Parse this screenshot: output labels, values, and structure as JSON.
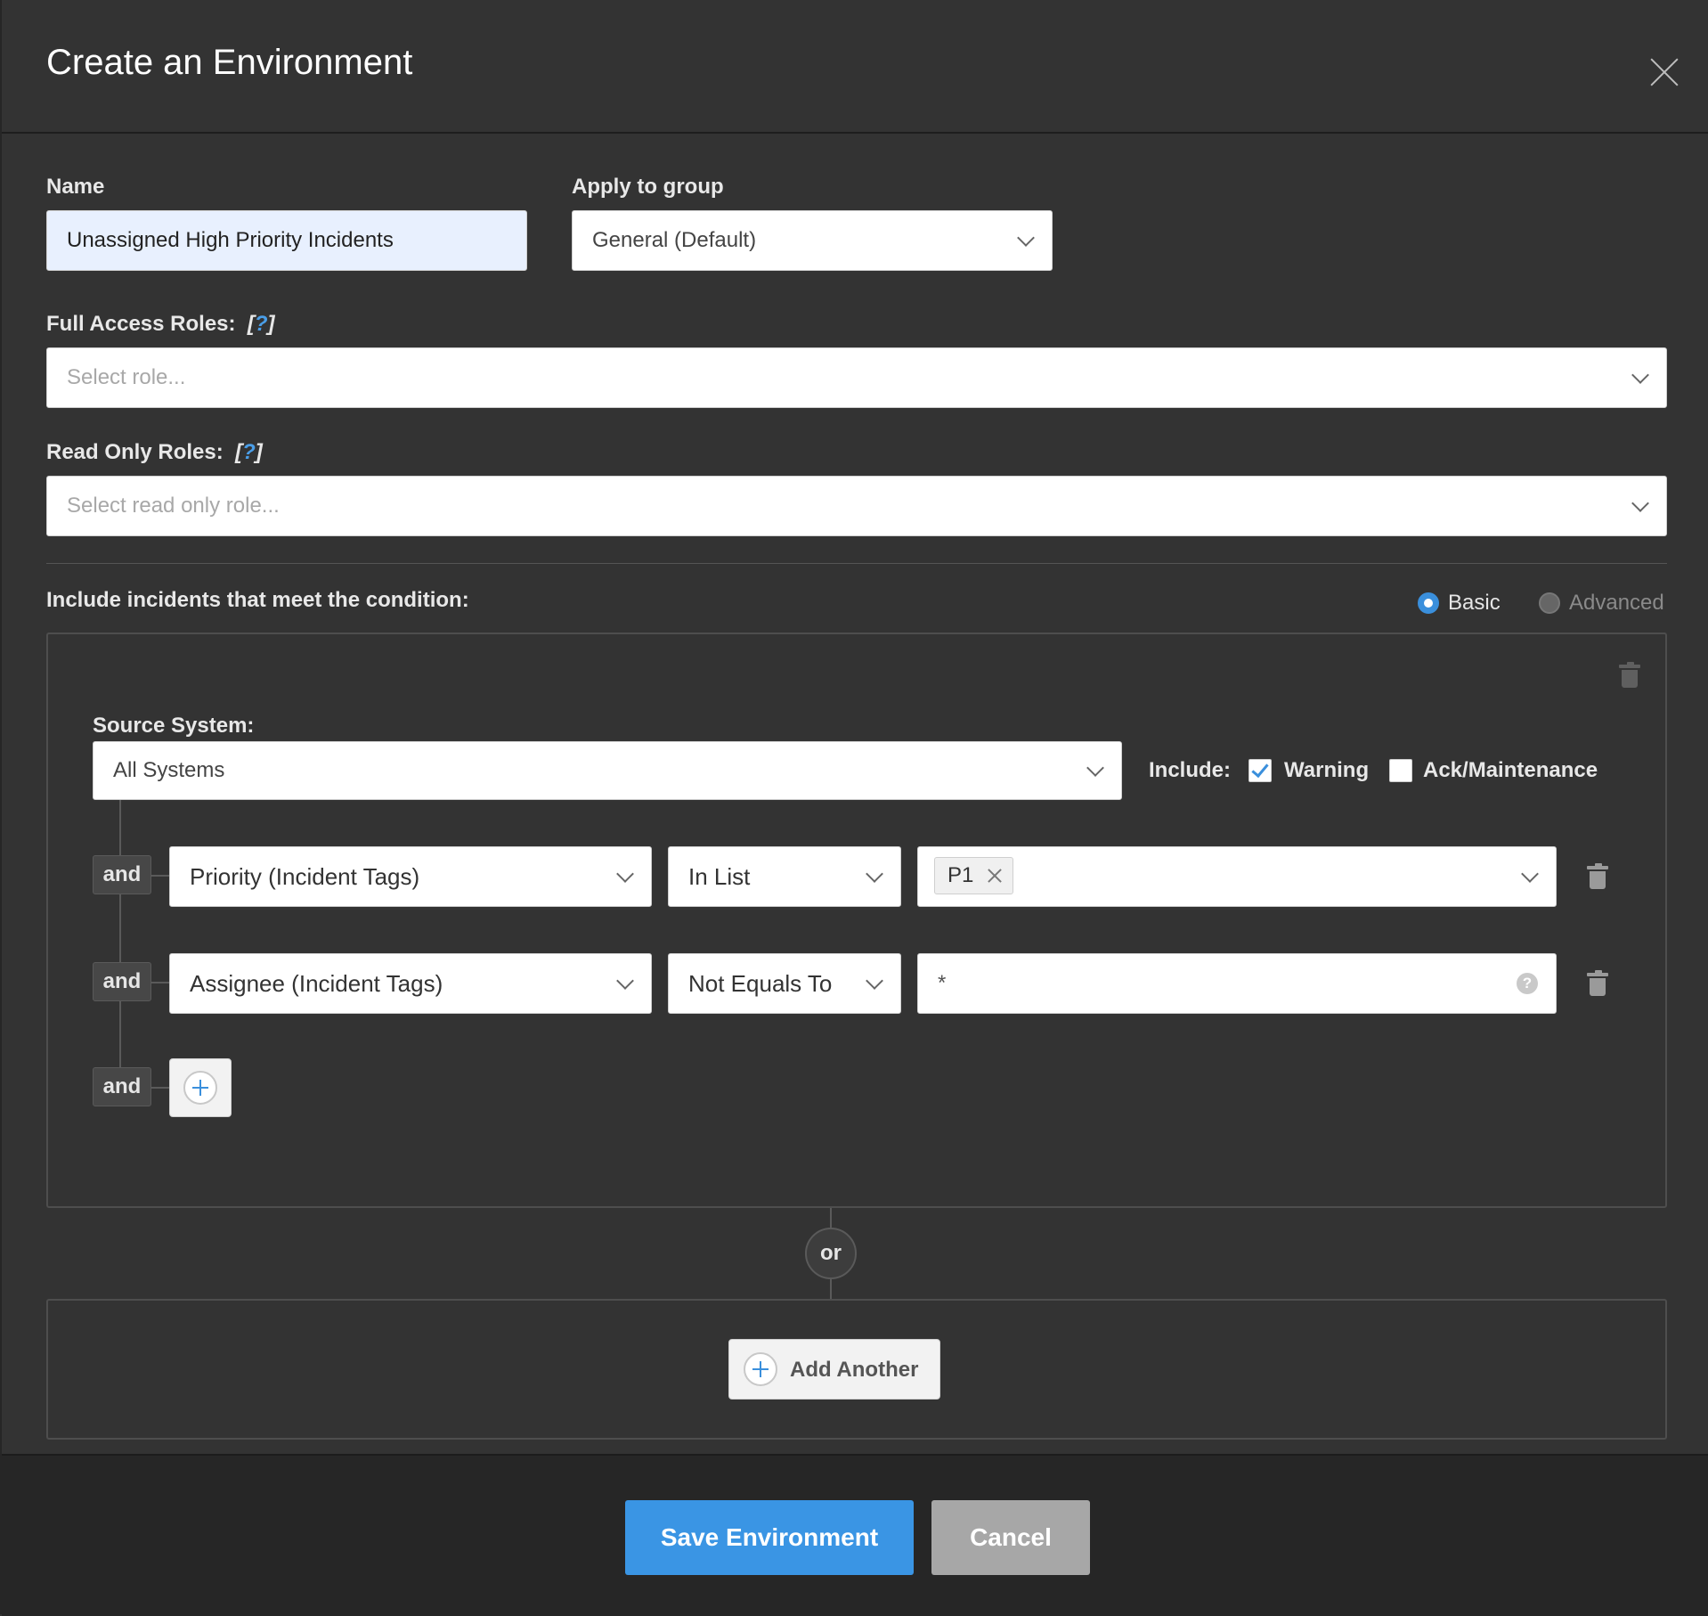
{
  "dialog": {
    "title": "Create an Environment"
  },
  "name_field": {
    "label": "Name",
    "value": "Unassigned High Priority Incidents"
  },
  "group_field": {
    "label": "Apply to group",
    "value": "General (Default)"
  },
  "full_access": {
    "label": "Full Access Roles:",
    "help": "?",
    "placeholder": "Select role..."
  },
  "read_only": {
    "label": "Read Only Roles:",
    "help": "?",
    "placeholder": "Select read only role..."
  },
  "conditions": {
    "label": "Include incidents that meet the condition:",
    "modes": {
      "basic": "Basic",
      "advanced": "Advanced",
      "selected": "Basic"
    },
    "source_system": {
      "label": "Source System:",
      "value": "All Systems"
    },
    "include": {
      "label": "Include:",
      "warning": {
        "label": "Warning",
        "checked": true
      },
      "ack": {
        "label": "Ack/Maintenance",
        "checked": false
      }
    },
    "rows": [
      {
        "connector": "and",
        "field": "Priority (Incident Tags)",
        "operator": "In List",
        "tags": [
          "P1"
        ]
      },
      {
        "connector": "and",
        "field": "Assignee (Incident Tags)",
        "operator": "Not Equals To",
        "value": "*"
      }
    ],
    "add_connector": "and"
  },
  "or_label": "or",
  "add_another": "Add Another",
  "footer": {
    "save": "Save Environment",
    "cancel": "Cancel"
  },
  "colors": {
    "accent": "#3a95e4",
    "background": "#333333",
    "footer": "#262626"
  }
}
